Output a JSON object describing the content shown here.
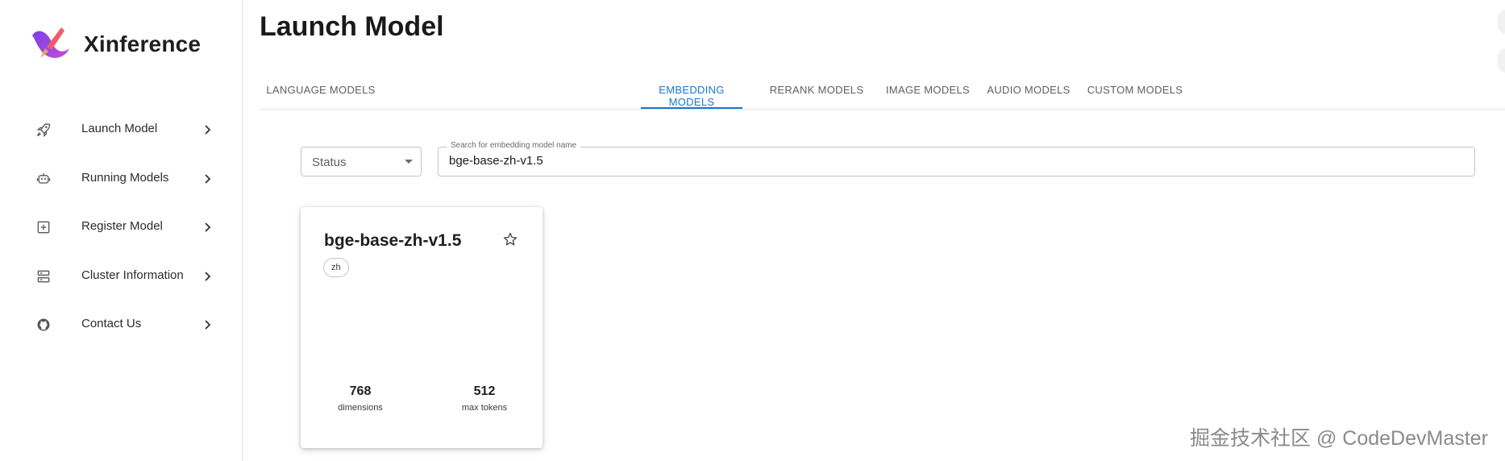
{
  "app": {
    "brand": "Xinference",
    "logo_icon": "xinference-rocket-logo"
  },
  "sidebar": {
    "items": [
      {
        "label": "Launch Model",
        "icon": "rocket-icon"
      },
      {
        "label": "Running Models",
        "icon": "robot-icon"
      },
      {
        "label": "Register Model",
        "icon": "add-box-icon"
      },
      {
        "label": "Cluster Information",
        "icon": "server-icon"
      },
      {
        "label": "Contact Us",
        "icon": "github-icon"
      }
    ]
  },
  "page": {
    "title": "Launch Model"
  },
  "tabs": [
    {
      "label": "LANGUAGE MODELS",
      "active": false
    },
    {
      "label": "EMBEDDING MODELS",
      "active": true
    },
    {
      "label": "RERANK MODELS",
      "active": false
    },
    {
      "label": "IMAGE MODELS",
      "active": false
    },
    {
      "label": "AUDIO MODELS",
      "active": false
    },
    {
      "label": "CUSTOM MODELS",
      "active": false
    }
  ],
  "filters": {
    "status_selected": "Status",
    "search_label": "Search for embedding model name",
    "search_value": "bge-base-zh-v1.5"
  },
  "model_card": {
    "name": "bge-base-zh-v1.5",
    "tag": "zh",
    "dimensions_value": "768",
    "dimensions_label": "dimensions",
    "max_tokens_value": "512",
    "max_tokens_label": "max tokens",
    "favorite_icon": "star-outline-icon"
  },
  "watermark": {
    "text": "掘金技术社区 @ CodeDevMaster"
  },
  "colors": {
    "accent": "#1976d2",
    "text_primary": "#1f1f1f",
    "border": "#c4c4c4"
  }
}
